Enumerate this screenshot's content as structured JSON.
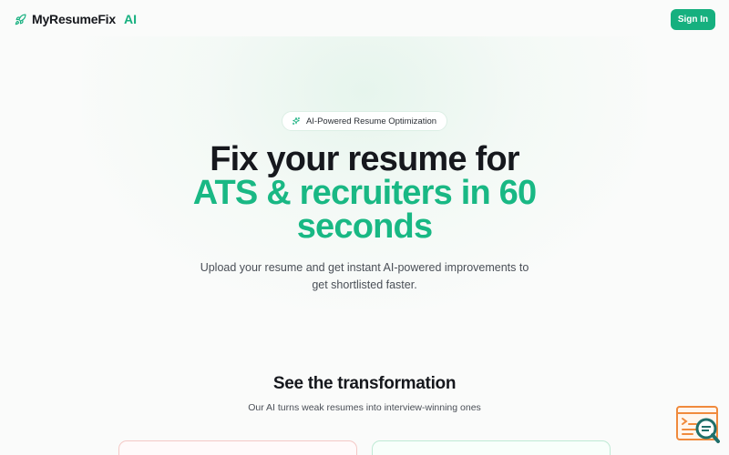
{
  "header": {
    "brand_name": "MyResumeFix",
    "brand_ai": "AI",
    "brand_icon": "rocket-icon",
    "signin_label": "Sign In"
  },
  "hero": {
    "badge_icon": "sparkles-icon",
    "badge_text": "AI-Powered Resume Optimization",
    "headline_line1": "Fix your resume for",
    "headline_accent_line1": "ATS & recruiters in 60",
    "headline_accent_line2": "seconds",
    "subtext": "Upload your resume and get instant AI-powered improvements to get shortlisted faster."
  },
  "transformation": {
    "title": "See the transformation",
    "subtitle": "Our AI turns weak resumes into interview-winning ones"
  },
  "colors": {
    "accent": "#16b07f",
    "text": "#16181d",
    "muted": "#4a4f57",
    "before_card_border": "#f4c9c6",
    "after_card_border": "#bfead5",
    "widget_orange": "#f08a3c",
    "widget_teal": "#1f6f6a"
  },
  "widget": {
    "icon": "document-search-icon"
  }
}
